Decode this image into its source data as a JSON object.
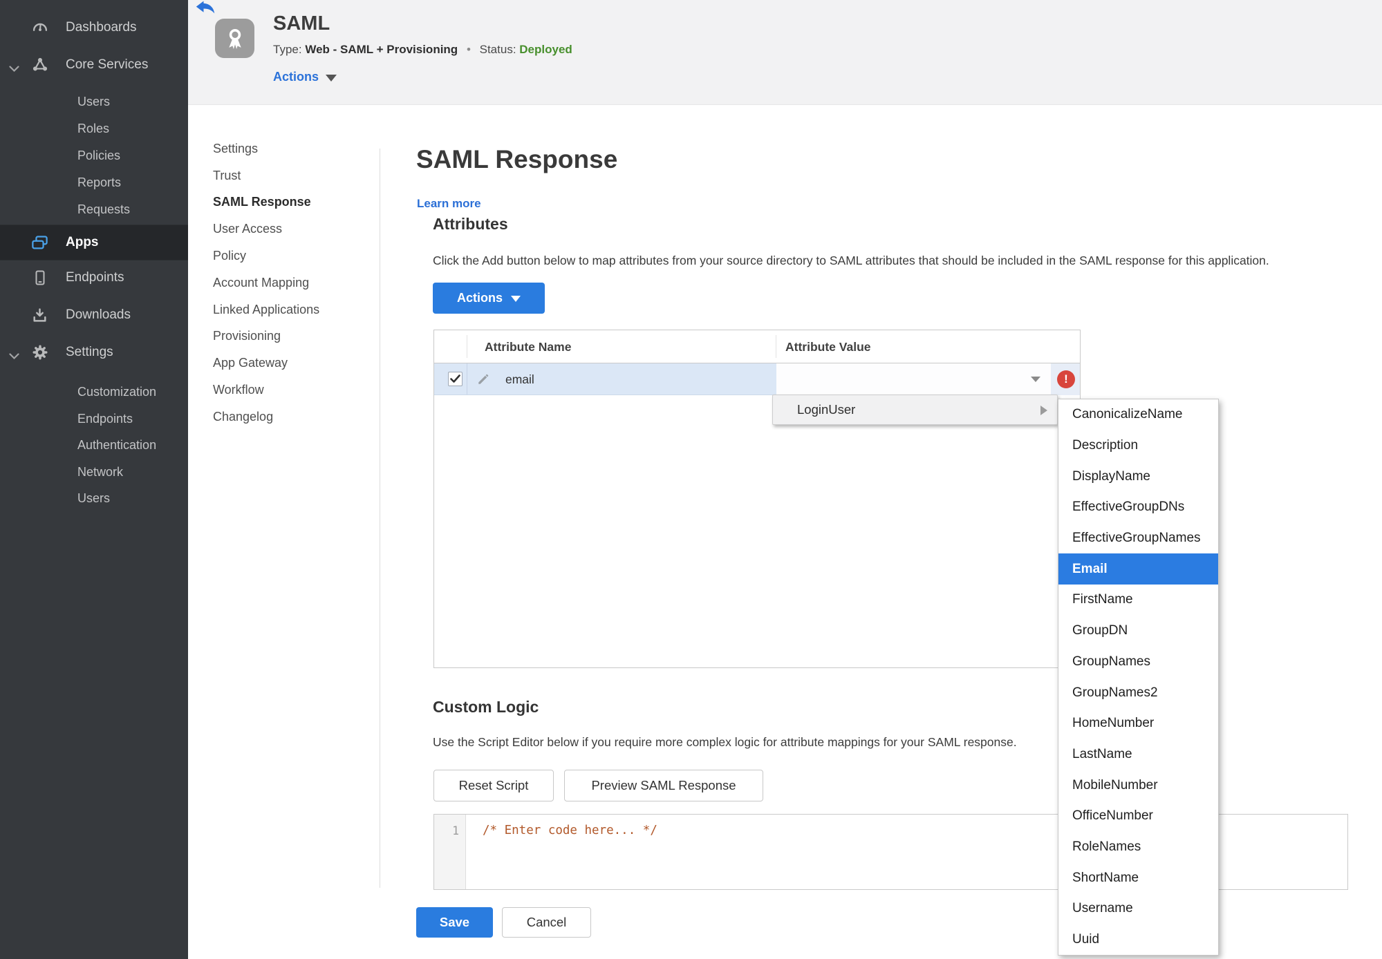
{
  "sidebar": {
    "dashboards": "Dashboards",
    "core_services": "Core Services",
    "core_children": [
      "Users",
      "Roles",
      "Policies",
      "Reports",
      "Requests"
    ],
    "apps": "Apps",
    "endpoints": "Endpoints",
    "downloads": "Downloads",
    "settings": "Settings",
    "settings_children": [
      "Customization",
      "Endpoints",
      "Authentication",
      "Network",
      "Users"
    ]
  },
  "header": {
    "title": "SAML",
    "type_label": "Type:",
    "type_value": "Web - SAML + Provisioning",
    "separator": "•",
    "status_label": "Status:",
    "status_value": "Deployed",
    "actions_label": "Actions"
  },
  "subnav": {
    "items": [
      "Settings",
      "Trust",
      "SAML Response",
      "User Access",
      "Policy",
      "Account Mapping",
      "Linked Applications",
      "Provisioning",
      "App Gateway",
      "Workflow",
      "Changelog"
    ],
    "selected": "SAML Response"
  },
  "main": {
    "title": "SAML Response",
    "learn_more": "Learn more",
    "attributes": {
      "heading": "Attributes",
      "description": "Click the Add button below to map attributes from your source directory to SAML attributes that should be included in the SAML response for this application.",
      "actions_button": "Actions",
      "table": {
        "columns": [
          "Attribute Name",
          "Attribute Value"
        ],
        "rows": [
          {
            "name": "email",
            "value": "",
            "checked": true,
            "error": true
          }
        ]
      }
    },
    "context_menu": {
      "label": "LoginUser"
    },
    "dropdown": {
      "items": [
        "CanonicalizeName",
        "Description",
        "DisplayName",
        "EffectiveGroupDNs",
        "EffectiveGroupNames",
        "Email",
        "FirstName",
        "GroupDN",
        "GroupNames",
        "GroupNames2",
        "HomeNumber",
        "LastName",
        "MobileNumber",
        "OfficeNumber",
        "RoleNames",
        "ShortName",
        "Username",
        "Uuid"
      ],
      "selected": "Email"
    },
    "custom_logic": {
      "heading": "Custom Logic",
      "description": "Use the Script Editor below if you require more complex logic for attribute mappings for your SAML response.",
      "reset_button": "Reset Script",
      "preview_button": "Preview SAML Response",
      "editor": {
        "line_number": "1",
        "code": "/* Enter code here... */"
      }
    },
    "footer": {
      "save": "Save",
      "cancel": "Cancel"
    }
  },
  "colors": {
    "accent_blue": "#2a7cdf",
    "selected_blue": "#2b7ce1",
    "status_green": "#478f2c",
    "error_red": "#d8453c",
    "row_highlight": "#dbe7f6",
    "sidebar_bg": "#36393d"
  }
}
